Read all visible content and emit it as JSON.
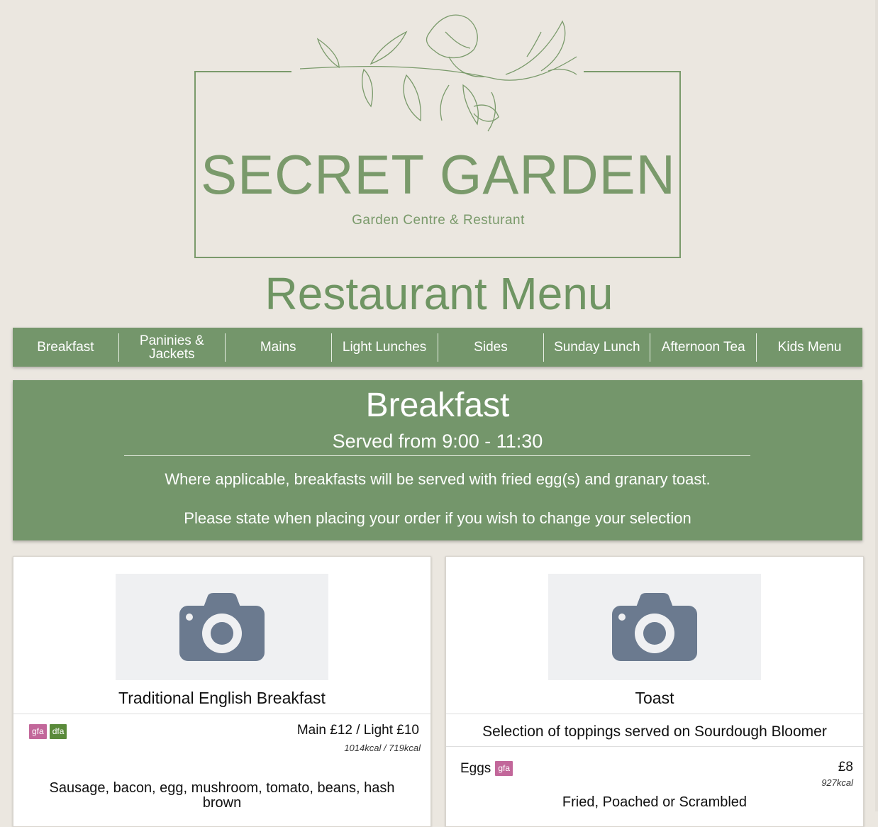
{
  "brand": {
    "name": "SECRET GARDEN",
    "tagline": "Garden Centre & Resturant"
  },
  "page_title": "Restaurant Menu",
  "colors": {
    "accent": "#74966b",
    "brand_green": "#7a9a6b",
    "background": "#ebe7e0",
    "badge_gfa": "#c2679a",
    "badge_dfa": "#5a8a3a",
    "placeholder_bg": "#eff0f2",
    "placeholder_icon": "#6b7a8f"
  },
  "nav": {
    "items": [
      {
        "label": "Breakfast"
      },
      {
        "label": "Paninies & Jackets"
      },
      {
        "label": "Mains"
      },
      {
        "label": "Light Lunches"
      },
      {
        "label": "Sides"
      },
      {
        "label": "Sunday Lunch"
      },
      {
        "label": "Afternoon Tea"
      },
      {
        "label": "Kids Menu"
      }
    ]
  },
  "section": {
    "title": "Breakfast",
    "served": "Served from 9:00 - 11:30",
    "note1": "Where applicable, breakfasts will be served with fried egg(s) and granary toast.",
    "note2": "Please state when placing your order if you wish to change your selection"
  },
  "cards": [
    {
      "image_icon": "camera-icon",
      "title": "Traditional English Breakfast",
      "badges": [
        "gfa",
        "dfa"
      ],
      "price": "Main £12 / Light £10",
      "kcal": "1014kcal / 719kcal",
      "description": "Sausage, bacon, egg, mushroom, tomato, beans, hash brown"
    },
    {
      "image_icon": "camera-icon",
      "title": "Toast",
      "subtitle": "Selection of toppings served on Sourdough Bloomer",
      "option": {
        "name": "Eggs",
        "badge": "gfa",
        "price": "£8",
        "kcal": "927kcal",
        "description": "Fried, Poached or Scrambled"
      }
    }
  ]
}
